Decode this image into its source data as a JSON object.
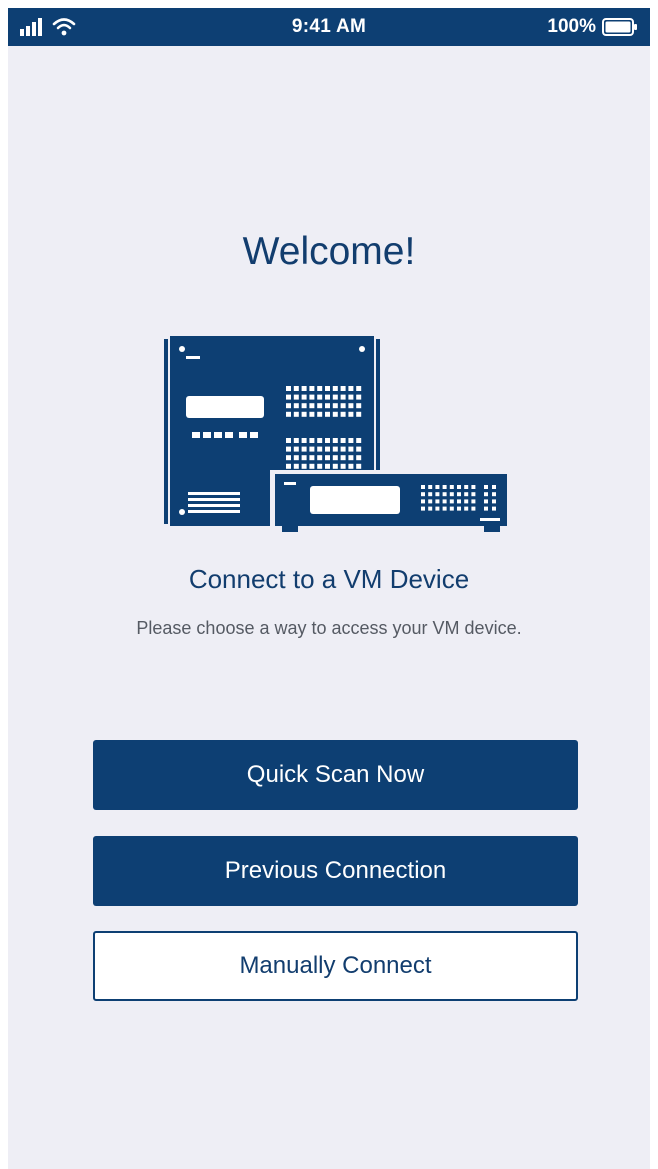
{
  "status_bar": {
    "time": "9:41 AM",
    "battery": "100%"
  },
  "welcome": {
    "title": "Welcome!"
  },
  "connect": {
    "title": "Connect to a VM Device",
    "description": "Please choose a way to access your VM device."
  },
  "buttons": {
    "quick_scan": "Quick Scan Now",
    "previous": "Previous Connection",
    "manual": "Manually Connect"
  },
  "colors": {
    "primary": "#0d3f73",
    "background": "#eeeef5",
    "text_dark": "#123d6e"
  },
  "icons": [
    "signal-icon",
    "wifi-icon",
    "battery-icon",
    "vm-device-illustration"
  ]
}
